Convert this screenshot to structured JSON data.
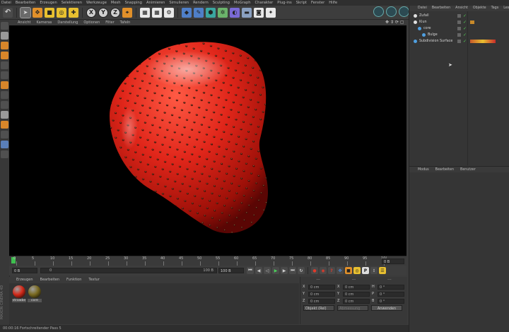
{
  "menubar": [
    "Datei",
    "Bearbeiten",
    "Erzeugen",
    "Selektieren",
    "Werkzeuge",
    "Mesh",
    "Snapping",
    "Animieren",
    "Simulieren",
    "Rendern",
    "Sculpting",
    "MoGraph",
    "Charakter",
    "Plug-ins",
    "Skript",
    "Fenster",
    "Hilfe"
  ],
  "toolbar": {
    "axis_x": "X",
    "axis_y": "Y",
    "axis_z": "Z"
  },
  "viewport_menu": [
    "Ansicht",
    "Kameras",
    "Darstellung",
    "Optionen",
    "Filter",
    "Tafeln"
  ],
  "timeline": {
    "ticks": [
      "0",
      "5",
      "10",
      "15",
      "20",
      "25",
      "30",
      "35",
      "40",
      "45",
      "50",
      "55",
      "60",
      "65",
      "70",
      "75",
      "80",
      "85",
      "90",
      "95",
      "10("
    ],
    "current_frame": "0 B"
  },
  "transport": {
    "start_field": "0 B",
    "slider_left": "0",
    "slider_right": "100 B",
    "end_field": "100 B"
  },
  "material_menu": [
    "Erzeugen",
    "Bearbeiten",
    "Funktion",
    "Textur"
  ],
  "materials": [
    {
      "name": "strawbe",
      "color": "#d42a1a"
    },
    {
      "name": "core",
      "color": "#7a6a20"
    }
  ],
  "coordinates": {
    "header": [
      "---",
      "---",
      "---"
    ],
    "rows": [
      {
        "a": "X",
        "av": "0 cm",
        "b": "X",
        "bv": "0 cm",
        "c": "H",
        "cv": "0 °"
      },
      {
        "a": "Y",
        "av": "0 cm",
        "b": "Y",
        "bv": "0 cm",
        "c": "P",
        "cv": "0 °"
      },
      {
        "a": "Z",
        "av": "0 cm",
        "b": "Z",
        "bv": "0 cm",
        "c": "B",
        "cv": "0 °"
      }
    ],
    "mode_select": "Objekt (Rel)",
    "size_select": "Abmessung",
    "apply_button": "Anwenden"
  },
  "status": "00:00:16 Fortschreitender Pass 5",
  "side_logo": "MAXON CINEMA 4D",
  "object_manager": {
    "menu": [
      "Datei",
      "Bearbeiten",
      "Ansicht",
      "Objekte",
      "Tags",
      "Lese"
    ],
    "objects": [
      {
        "name": "Zufall",
        "indent": 0
      },
      {
        "name": "Kiun",
        "indent": 0
      },
      {
        "name": "core",
        "indent": 1
      },
      {
        "name": "Bulge",
        "indent": 2
      },
      {
        "name": "Subdivision Surface",
        "indent": 0
      }
    ]
  },
  "attribute_menu": [
    "Modus",
    "Bearbeiten",
    "Benutzer"
  ],
  "colors": {
    "accent": "#e1902a",
    "strawberry": "#d42a1a",
    "viewport_bg": "#000000"
  }
}
